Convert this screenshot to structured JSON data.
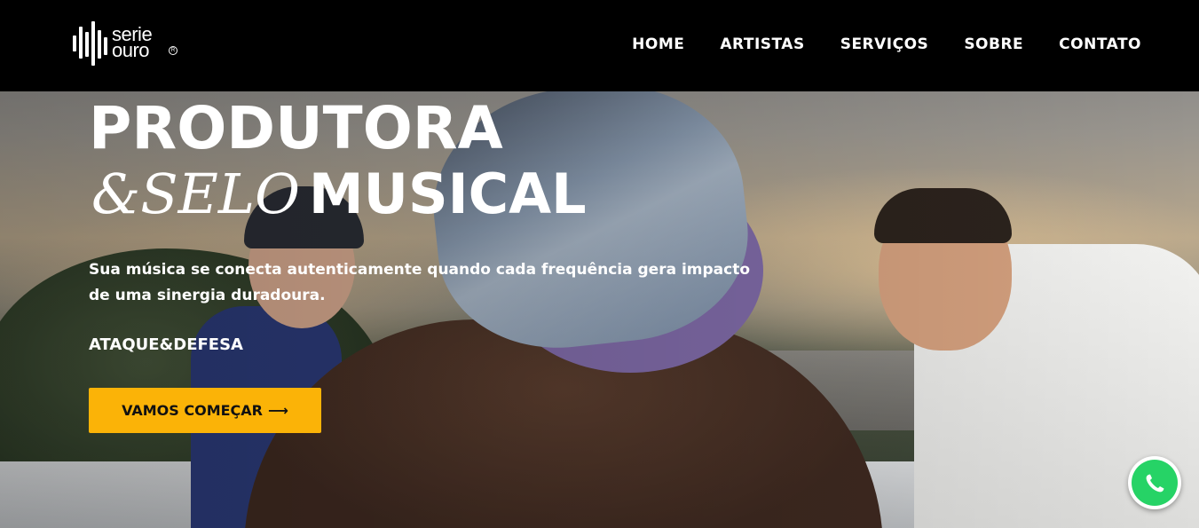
{
  "brand": {
    "logo_line1": "serie",
    "logo_line2": "ouro",
    "logo_reg": "R"
  },
  "nav": {
    "items": [
      {
        "label": "HOME"
      },
      {
        "label": "ARTISTAS"
      },
      {
        "label": "SERVIÇOS"
      },
      {
        "label": "SOBRE"
      },
      {
        "label": "CONTATO"
      }
    ]
  },
  "hero": {
    "headline_line1": "PRODUTORA",
    "headline_italic": "&SELO",
    "headline_bold": "MUSICAL",
    "subtitle": "Sua música se conecta autenticamente quando cada frequência gera impacto de uma sinergia duradoura.",
    "tagline": "ATAQUE&DEFESA",
    "cta_label": "VAMOS COMEÇAR",
    "cta_arrow": "⟶",
    "background_image": "photo-of-three-men-on-rooftop"
  },
  "whatsapp": {
    "icon": "whatsapp-icon"
  },
  "colors": {
    "header_bg": "#000000",
    "accent": "#fbb307",
    "text": "#ffffff",
    "whatsapp": "#26d366"
  }
}
